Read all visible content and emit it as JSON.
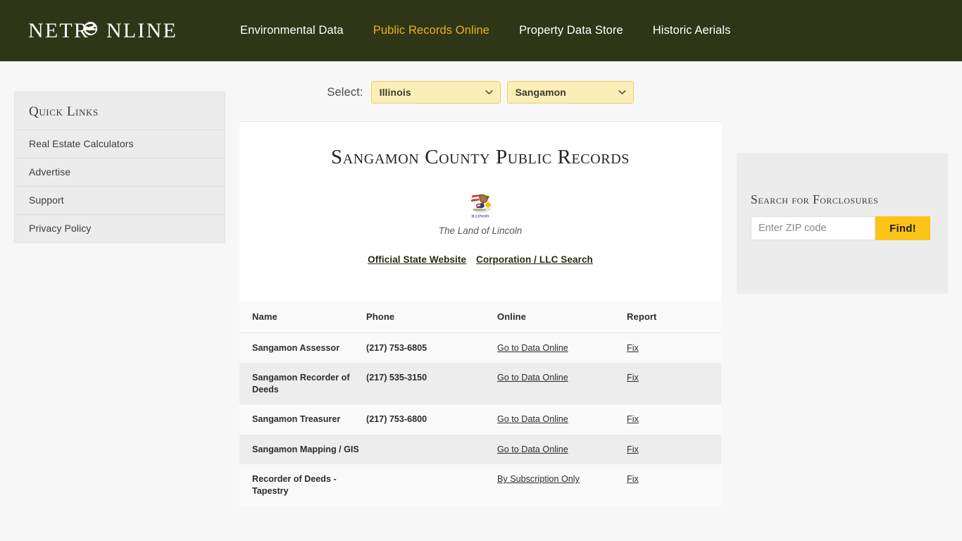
{
  "brand": {
    "logo_text_before": "NETR",
    "logo_text_after": "NLINE",
    "logo_full": "NETRONLINE",
    "globe_icon": "globe-icon"
  },
  "nav": {
    "items": [
      {
        "label": "Environmental Data",
        "active": false
      },
      {
        "label": "Public Records Online",
        "active": true
      },
      {
        "label": "Property Data Store",
        "active": false
      },
      {
        "label": "Historic Aerials",
        "active": false
      }
    ]
  },
  "sidebar": {
    "title": "Quick Links",
    "items": [
      {
        "label": "Real Estate Calculators"
      },
      {
        "label": "Advertise"
      },
      {
        "label": "Support"
      },
      {
        "label": "Privacy Policy"
      }
    ]
  },
  "selector": {
    "label": "Select:",
    "state": {
      "value": "Illinois",
      "icon": "chevron-down-icon"
    },
    "county": {
      "value": "Sangamon",
      "icon": "chevron-down-icon"
    }
  },
  "main": {
    "title": "Sangamon County Public Records",
    "seal_icon": "illinois-state-seal",
    "seal_caption": "ILLINOIS",
    "motto": "The Land of Lincoln",
    "links": [
      {
        "label": "Official State Website"
      },
      {
        "label": "Corporation / LLC Search"
      }
    ]
  },
  "table": {
    "columns": [
      "Name",
      "Phone",
      "Online",
      "Report"
    ],
    "rows": [
      {
        "name": "Sangamon Assessor",
        "phone": "(217) 753-6805",
        "online": "Go to Data Online",
        "report": "Fix"
      },
      {
        "name": "Sangamon Recorder of Deeds",
        "phone": "(217) 535-3150",
        "online": "Go to Data Online",
        "report": "Fix"
      },
      {
        "name": "Sangamon Treasurer",
        "phone": "(217) 753-6800",
        "online": "Go to Data Online",
        "report": "Fix"
      },
      {
        "name": "Sangamon Mapping / GIS",
        "phone": "",
        "online": "Go to Data Online",
        "report": "Fix"
      },
      {
        "name": "Recorder of Deeds - Tapestry",
        "phone": "",
        "online": "By Subscription Only",
        "report": "Fix"
      }
    ]
  },
  "foreclosure": {
    "title": "Search for Forclosures",
    "zip_placeholder": "Enter ZIP code",
    "zip_value": "",
    "button_label": "Find!"
  },
  "colors": {
    "header_bg": "#2f3617",
    "nav_active": "#ebb21a",
    "dropdown_bg": "#fbeeb6",
    "dropdown_border": "#e9cf68",
    "button_gold": "#fcc419",
    "panel_gray": "#ececec",
    "row_alt": "#ededed",
    "page_bg": "#f7f7f7"
  }
}
